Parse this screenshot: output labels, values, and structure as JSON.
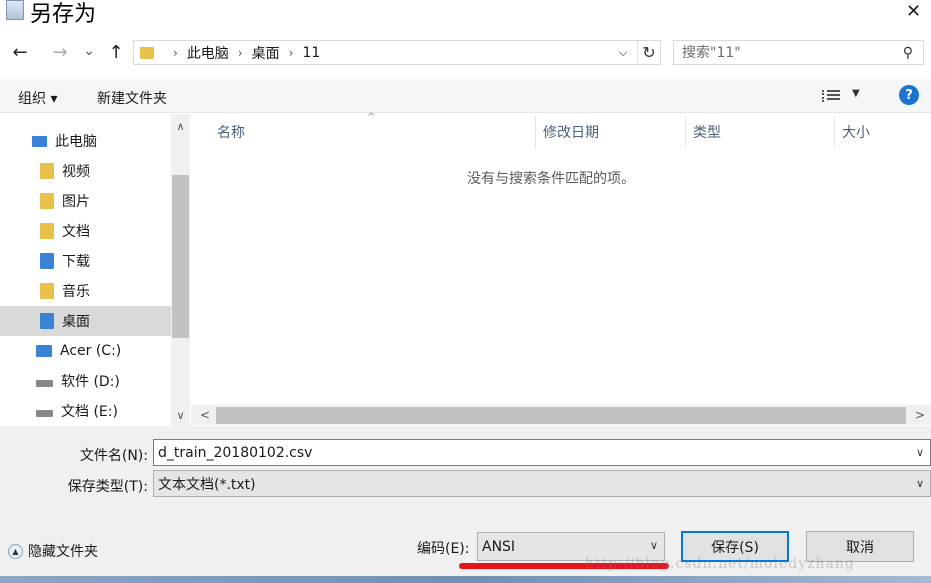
{
  "window": {
    "title": "另存为",
    "close_glyph": "✕"
  },
  "nav": {
    "back_glyph": "←",
    "forward_glyph": "→",
    "recent_glyph": "⌄",
    "up_glyph": "↑",
    "breadcrumbs": [
      "此电脑",
      "桌面",
      "11"
    ],
    "breadcrumb_sep": "›",
    "refresh_glyph": "↻",
    "dropdown_glyph": "⌵"
  },
  "search": {
    "placeholder": "搜索\"11\"",
    "icon": "search-icon"
  },
  "toolbar": {
    "organize_label": "组织 ▾",
    "new_folder_label": "新建文件夹",
    "help_label": "?",
    "view_caret": "▼"
  },
  "sidebar": {
    "items": [
      {
        "label": "此电脑",
        "icon": "computer-icon",
        "color": "#3a82d6"
      },
      {
        "label": "视频",
        "icon": "videos-folder-icon",
        "color": "#e8c04a"
      },
      {
        "label": "图片",
        "icon": "pictures-folder-icon",
        "color": "#e8c04a"
      },
      {
        "label": "文档",
        "icon": "documents-folder-icon",
        "color": "#e8c04a"
      },
      {
        "label": "下载",
        "icon": "downloads-folder-icon",
        "color": "#3a82d6"
      },
      {
        "label": "音乐",
        "icon": "music-folder-icon",
        "color": "#e8c04a"
      },
      {
        "label": "桌面",
        "icon": "desktop-folder-icon",
        "color": "#3a82d6"
      },
      {
        "label": "Acer (C:)",
        "icon": "windows-drive-icon",
        "color": "#3a82d6"
      },
      {
        "label": "软件 (D:)",
        "icon": "drive-icon",
        "color": "#888888"
      },
      {
        "label": "文档 (E:)",
        "icon": "drive-icon",
        "color": "#888888"
      }
    ],
    "selected_index": 6
  },
  "file_list": {
    "columns": [
      "名称",
      "修改日期",
      "类型",
      "大小"
    ],
    "empty_message": "没有与搜索条件匹配的项。",
    "sort_glyph": "^"
  },
  "scroll": {
    "up": "∧",
    "down": "∨",
    "left": "<",
    "right": ">"
  },
  "form": {
    "filename_label": "文件名(N):",
    "filename_value": "d_train_20180102.csv",
    "savetype_label": "保存类型(T):",
    "savetype_value": "文本文档(*.txt)",
    "encoding_label": "编码(E):",
    "encoding_value": "ANSI",
    "caret": "∨"
  },
  "buttons": {
    "hide_folders": "隐藏文件夹",
    "save": "保存(S)",
    "cancel": "取消"
  },
  "watermark": "http://blog.csdn.net/moledyzhang",
  "colors": {
    "accent": "#0078d7",
    "help": "#1b74d1",
    "highlight": "#e8141b",
    "selected": "#d9d9d9"
  }
}
